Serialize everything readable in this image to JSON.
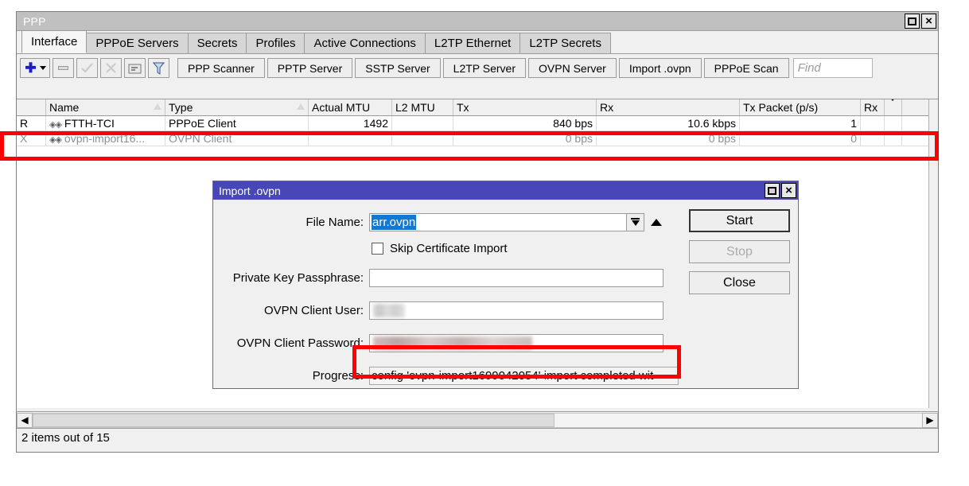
{
  "window": {
    "title": "PPP",
    "restore_label": "Restore",
    "close_label": "×"
  },
  "tabs": [
    {
      "label": "Interface",
      "active": true
    },
    {
      "label": "PPPoE Servers",
      "active": false
    },
    {
      "label": "Secrets",
      "active": false
    },
    {
      "label": "Profiles",
      "active": false
    },
    {
      "label": "Active Connections",
      "active": false
    },
    {
      "label": "L2TP Ethernet",
      "active": false
    },
    {
      "label": "L2TP Secrets",
      "active": false
    }
  ],
  "toolbar": {
    "add_label": "+",
    "add_icon": "plus-icon",
    "remove_icon": "minus-icon",
    "enable_icon": "check-icon",
    "disable_icon": "cross-icon",
    "comment_icon": "comment-icon",
    "filter_icon": "funnel-icon",
    "buttons": [
      {
        "label": "PPP Scanner"
      },
      {
        "label": "PPTP Server"
      },
      {
        "label": "SSTP Server"
      },
      {
        "label": "L2TP Server"
      },
      {
        "label": "OVPN Server"
      },
      {
        "label": "Import .ovpn"
      },
      {
        "label": "PPPoE Scan"
      }
    ],
    "find_placeholder": "Find",
    "find_value": ""
  },
  "table": {
    "columns": [
      {
        "key": "flag",
        "label": ""
      },
      {
        "key": "name",
        "label": "Name",
        "sorted": true
      },
      {
        "key": "type",
        "label": "Type",
        "sorted": true
      },
      {
        "key": "actual_mtu",
        "label": "Actual MTU"
      },
      {
        "key": "l2_mtu",
        "label": "L2 MTU"
      },
      {
        "key": "tx",
        "label": "Tx"
      },
      {
        "key": "rx",
        "label": "Rx"
      },
      {
        "key": "tx_packet",
        "label": "Tx Packet (p/s)"
      },
      {
        "key": "rx_packet",
        "label": "Rx"
      }
    ],
    "rows": [
      {
        "flag": "R",
        "name": "FTTH-TCI",
        "type": "PPPoE Client",
        "actual_mtu": "1492",
        "l2_mtu": "",
        "tx": "840 bps",
        "rx": "10.6 kbps",
        "tx_packet": "1",
        "rx_packet": "",
        "dimmed": false
      },
      {
        "flag": "X",
        "name": "ovpn-import16...",
        "type": "OVPN Client",
        "actual_mtu": "",
        "l2_mtu": "",
        "tx": "0 bps",
        "rx": "0 bps",
        "tx_packet": "0",
        "rx_packet": "",
        "dimmed": true
      }
    ]
  },
  "statusbar": {
    "text": "2 items out of 15"
  },
  "scrollbar": {
    "left_arrow": "◀",
    "right_arrow": "▶"
  },
  "dialog": {
    "title": "Import .ovpn",
    "restore_label": "Restore",
    "close_label": "×",
    "fields": {
      "file_name_label": "File Name:",
      "file_name_value": "arr.ovpn",
      "skip_cert_label": "Skip Certificate Import",
      "skip_cert_checked": false,
      "passphrase_label": "Private Key Passphrase:",
      "passphrase_value": "",
      "user_label": "OVPN Client User:",
      "user_value": "",
      "password_label": "OVPN Client Password:",
      "password_value": "",
      "progress_label": "Progress:",
      "progress_value": "config 'ovpn-import1699042054' import completed wit"
    },
    "buttons": {
      "start": "Start",
      "stop": "Stop",
      "close": "Close"
    }
  },
  "annotations": {
    "accent_color": "#ff0000",
    "row_highlight": "ovpn-client-row",
    "progress_highlight": "progress-field"
  }
}
